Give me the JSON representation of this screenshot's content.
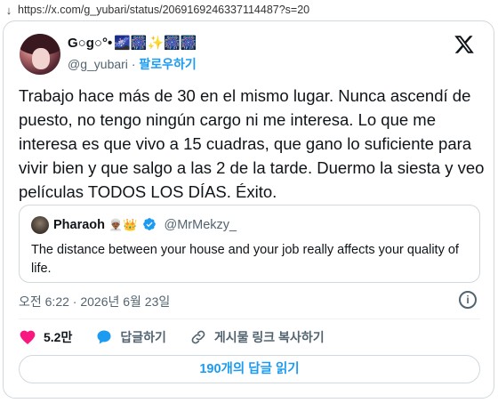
{
  "browser": {
    "url": "https://x.com/g_yubari/status/2069169246337114487?s=20"
  },
  "author": {
    "display_name": "G○g○°•",
    "name_emojis": "🌌🎆✨🎆🎆",
    "handle": "@g_yubari",
    "separator": "·",
    "follow_label": "팔로우하기"
  },
  "tweet": {
    "text": "Trabajo hace más de 30 en el mismo lugar. Nunca ascendí de puesto, no tengo ningún cargo ni me interesa. Lo que me interesa es que vivo a 15 cuadras, que gano lo suficiente para vivir bien y que salgo a las 2 de la tarde. Duermo la siesta y veo películas TODOS LOS DÍAS. Éxito."
  },
  "quote": {
    "display_name": "Pharaoh",
    "name_emojis": "👳🏾‍♂️👑",
    "handle": "@MrMekzy_",
    "text": "The distance between your house and your job really affects your quality of life."
  },
  "meta": {
    "timestamp": "오전 6:22 · 2026년 6월 23일",
    "info_glyph": "i"
  },
  "actions": {
    "like_count": "5.2만",
    "reply_label": "답글하기",
    "copy_link_label": "게시물 링크 복사하기"
  },
  "replies_button": {
    "label": "190개의 답글 읽기"
  },
  "colors": {
    "accent": "#1d9bf0",
    "like": "#f91880",
    "muted": "#536471",
    "border": "#cfd9de"
  }
}
